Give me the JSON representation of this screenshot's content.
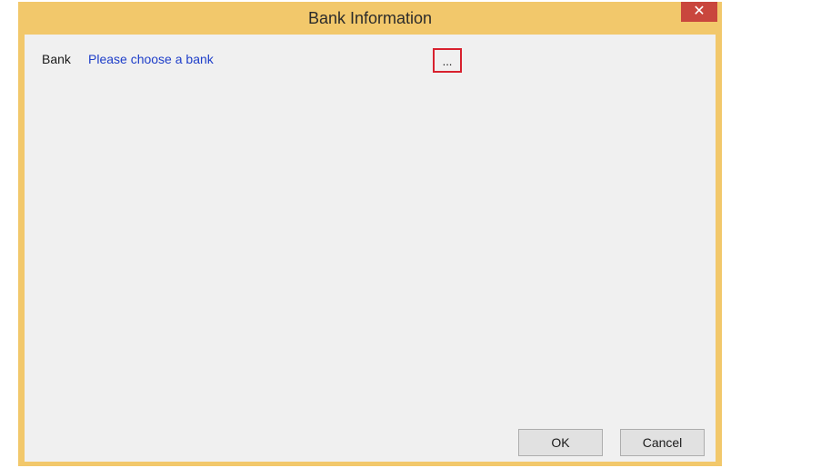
{
  "window": {
    "title": "Bank Information",
    "close_glyph": "✕"
  },
  "form": {
    "bank_label": "Bank",
    "bank_value": "Please choose a bank",
    "browse_label": "..."
  },
  "buttons": {
    "ok": "OK",
    "cancel": "Cancel"
  },
  "colors": {
    "titlebar": "#f2c86b",
    "close": "#c9463d",
    "link": "#1e3ec9",
    "highlight": "#d8212e"
  }
}
